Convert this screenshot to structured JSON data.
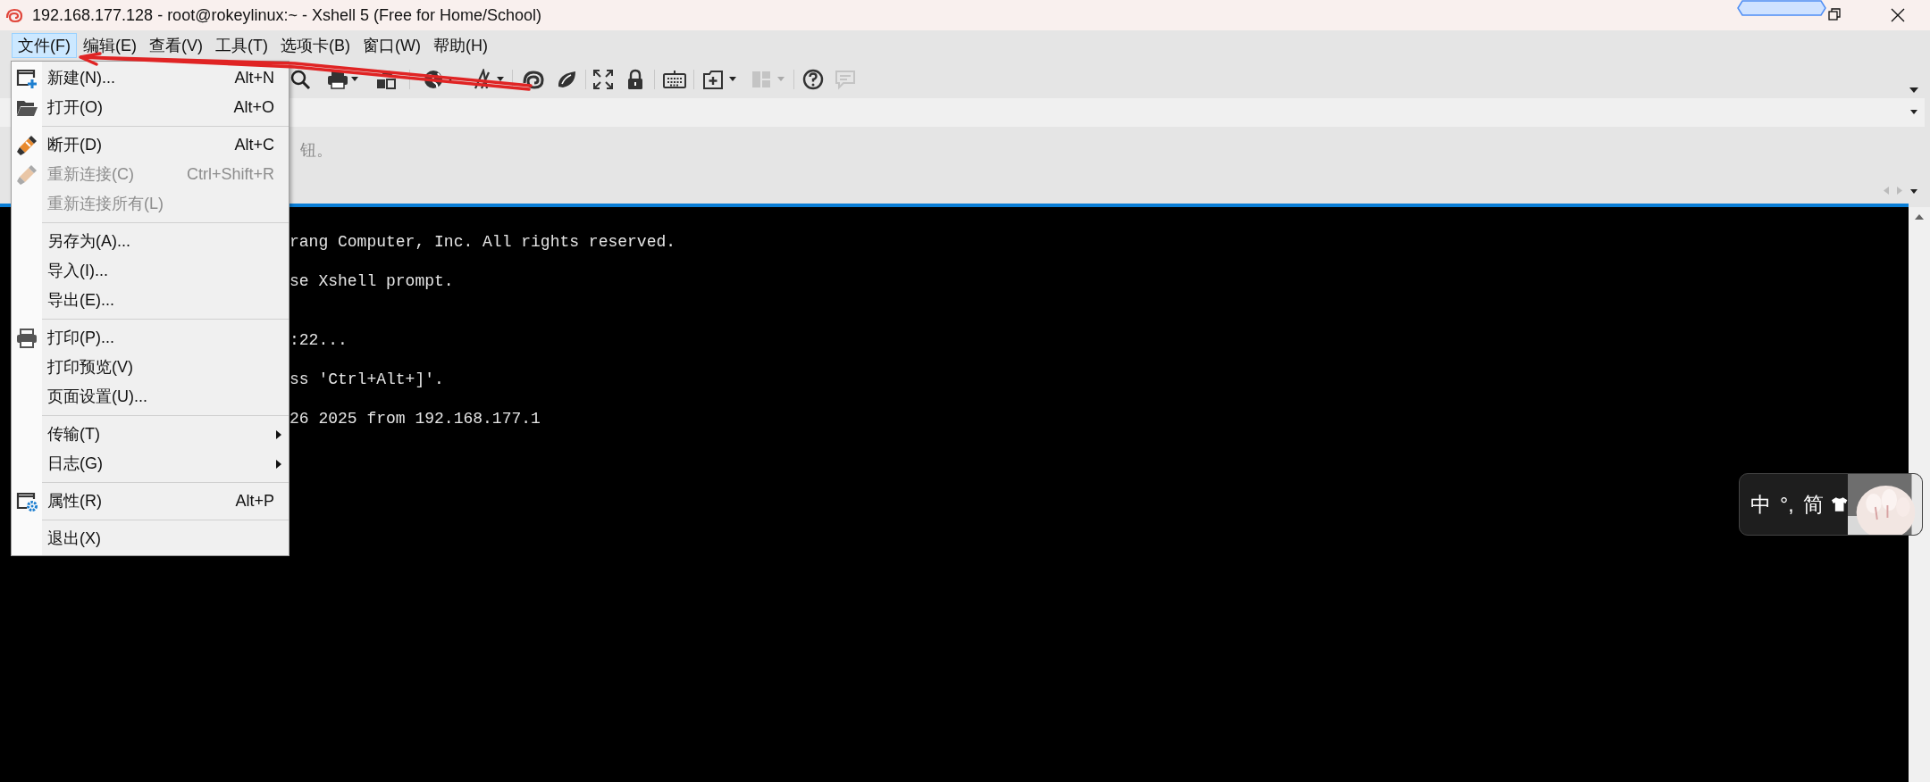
{
  "window": {
    "title": "192.168.177.128 - root@rokeylinux:~ - Xshell 5 (Free for Home/School)"
  },
  "menu_bar": [
    {
      "label": "文件(F)",
      "selected": true
    },
    {
      "label": "编辑(E)",
      "selected": false
    },
    {
      "label": "查看(V)",
      "selected": false
    },
    {
      "label": "工具(T)",
      "selected": false
    },
    {
      "label": "选项卡(B)",
      "selected": false
    },
    {
      "label": "窗口(W)",
      "selected": false
    },
    {
      "label": "帮助(H)",
      "selected": false
    }
  ],
  "file_menu": [
    {
      "kind": "item",
      "label": "新建(N)...",
      "shortcut": "Alt+N",
      "disabled": false
    },
    {
      "kind": "item",
      "label": "打开(O)",
      "shortcut": "Alt+O",
      "disabled": false
    },
    {
      "kind": "separator"
    },
    {
      "kind": "item",
      "label": "断开(D)",
      "shortcut": "Alt+C",
      "disabled": false
    },
    {
      "kind": "item",
      "label": "重新连接(C)",
      "shortcut": "Ctrl+Shift+R",
      "disabled": true
    },
    {
      "kind": "item",
      "label": "重新连接所有(L)",
      "disabled": true
    },
    {
      "kind": "separator"
    },
    {
      "kind": "item",
      "label": "另存为(A)...",
      "disabled": false
    },
    {
      "kind": "item",
      "label": "导入(I)...",
      "disabled": false
    },
    {
      "kind": "item",
      "label": "导出(E)...",
      "disabled": false
    },
    {
      "kind": "separator"
    },
    {
      "kind": "item",
      "label": "打印(P)...",
      "disabled": false
    },
    {
      "kind": "item",
      "label": "打印预览(V)",
      "disabled": false
    },
    {
      "kind": "item",
      "label": "页面设置(U)...",
      "disabled": false
    },
    {
      "kind": "separator"
    },
    {
      "kind": "submenu",
      "label": "传输(T)",
      "disabled": false
    },
    {
      "kind": "submenu",
      "label": "日志(G)",
      "disabled": false
    },
    {
      "kind": "separator"
    },
    {
      "kind": "item",
      "label": "属性(R)",
      "shortcut": "Alt+P",
      "disabled": false
    },
    {
      "kind": "separator"
    },
    {
      "kind": "item",
      "label": "退出(X)",
      "disabled": false
    }
  ],
  "hint_bar": {
    "text": "钮。"
  },
  "terminal": {
    "lines": [
      {
        "kind": "blank"
      },
      {
        "kind": "text",
        "right": "rang Computer, Inc. All rights reserved."
      },
      {
        "kind": "blank"
      },
      {
        "kind": "text",
        "right": "se Xshell prompt."
      },
      {
        "kind": "blank"
      },
      {
        "kind": "blank"
      },
      {
        "kind": "text",
        "right": ":22..."
      },
      {
        "kind": "blank"
      },
      {
        "kind": "text",
        "right": "ss 'Ctrl+Alt+]'."
      },
      {
        "kind": "blank"
      },
      {
        "kind": "text",
        "right": "26 2025 from 192.168.177.1"
      }
    ]
  },
  "ime_bar": {
    "items": [
      "中",
      "°,",
      "简"
    ]
  }
}
